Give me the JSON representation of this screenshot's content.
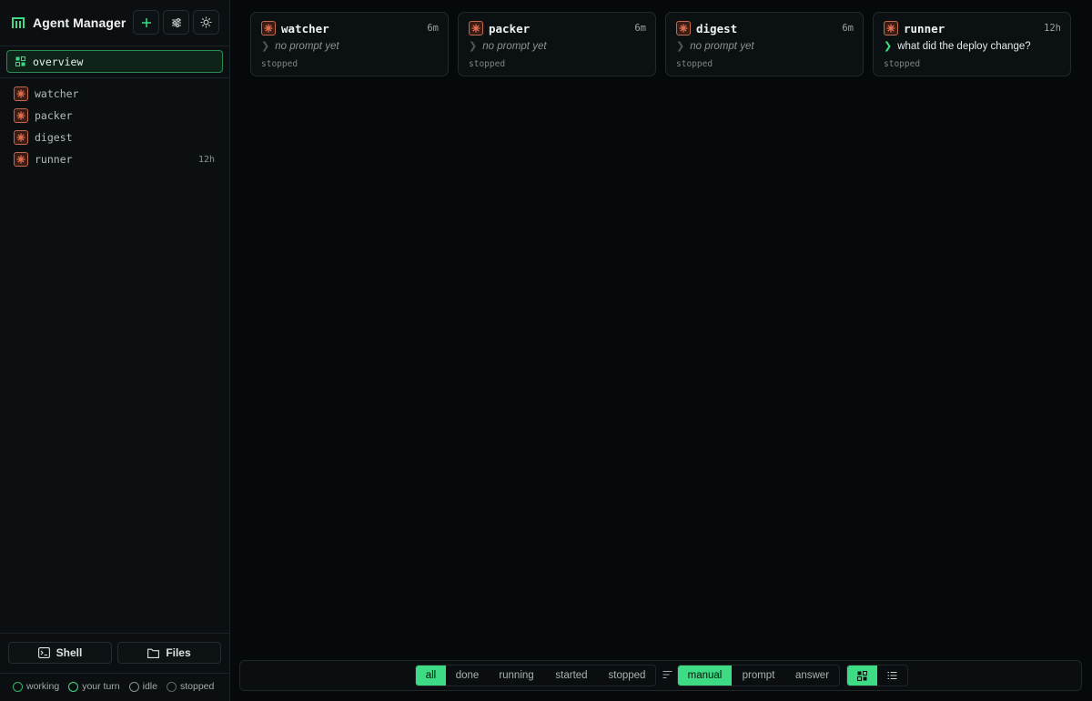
{
  "app": {
    "title": "Agent Manager"
  },
  "sidebar": {
    "overview_label": "overview",
    "agents": [
      {
        "name": "watcher",
        "age": ""
      },
      {
        "name": "packer",
        "age": ""
      },
      {
        "name": "digest",
        "age": ""
      },
      {
        "name": "runner",
        "age": "12h"
      }
    ],
    "shell_label": "Shell",
    "files_label": "Files",
    "legend": [
      "working",
      "your turn",
      "idle",
      "stopped"
    ]
  },
  "cards": [
    {
      "name": "watcher",
      "age": "6m",
      "prompt": "no prompt yet",
      "status": "stopped"
    },
    {
      "name": "packer",
      "age": "6m",
      "prompt": "no prompt yet",
      "status": "stopped"
    },
    {
      "name": "digest",
      "age": "6m",
      "prompt": "no prompt yet",
      "status": "stopped"
    },
    {
      "name": "runner",
      "age": "12h",
      "prompt": "what did the deploy change?",
      "status": "stopped"
    }
  ],
  "filters": {
    "status": [
      "all",
      "done",
      "running",
      "started",
      "stopped"
    ],
    "status_selected": "all",
    "sort": [
      "manual",
      "prompt",
      "answer"
    ],
    "sort_selected": "manual",
    "view_selected": "grid"
  },
  "colors": {
    "accent": "#3ddc84",
    "agent_icon": "#e0704f",
    "background": "#06090a"
  }
}
